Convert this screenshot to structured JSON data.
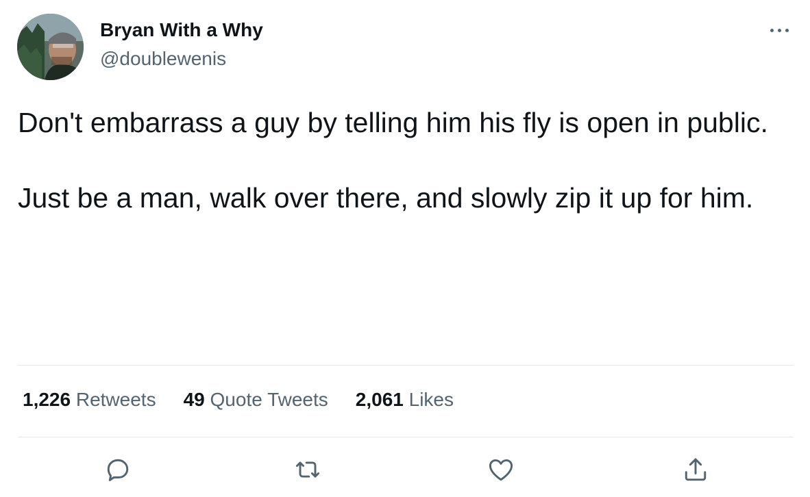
{
  "author": {
    "display_name": "Bryan With a Why",
    "handle": "@doublewenis"
  },
  "tweet": {
    "paragraphs": [
      "Don't embarrass a guy by telling him his fly is open in public.",
      "Just be a man, walk over there, and slowly zip it up for him."
    ]
  },
  "stats": {
    "retweets_count": "1,226",
    "retweets_label": "Retweets",
    "quotes_count": "49",
    "quotes_label": "Quote Tweets",
    "likes_count": "2,061",
    "likes_label": "Likes"
  },
  "actions": {
    "reply_icon": "reply-icon",
    "retweet_icon": "retweet-icon",
    "like_icon": "heart-icon",
    "share_icon": "share-icon",
    "more_icon": "more-icon"
  },
  "colors": {
    "text_primary": "#0f1419",
    "text_secondary": "#536471",
    "divider": "#e4e8eb"
  }
}
